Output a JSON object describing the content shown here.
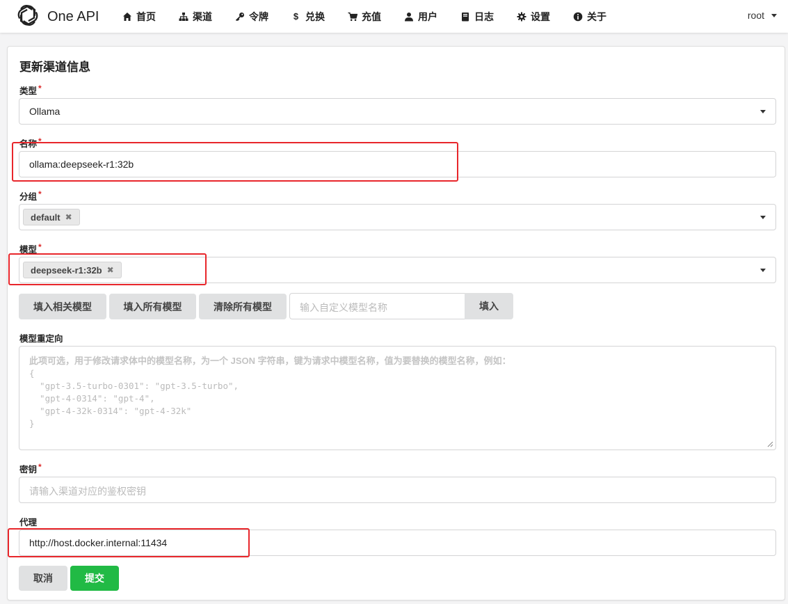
{
  "app": {
    "name": "One API"
  },
  "nav": [
    {
      "label": "首页",
      "icon": "home-icon"
    },
    {
      "label": "渠道",
      "icon": "sitemap-icon"
    },
    {
      "label": "令牌",
      "icon": "key-icon"
    },
    {
      "label": "兑换",
      "icon": "dollar-icon"
    },
    {
      "label": "充值",
      "icon": "cart-icon"
    },
    {
      "label": "用户",
      "icon": "user-icon"
    },
    {
      "label": "日志",
      "icon": "book-icon"
    },
    {
      "label": "设置",
      "icon": "gear-icon"
    },
    {
      "label": "关于",
      "icon": "info-icon"
    }
  ],
  "user": {
    "name": "root"
  },
  "form": {
    "title": "更新渠道信息",
    "required_mark": "*",
    "type": {
      "label": "类型",
      "value": "Ollama"
    },
    "name": {
      "label": "名称",
      "value": "ollama:deepseek-r1:32b"
    },
    "group": {
      "label": "分组",
      "chips": [
        "default"
      ]
    },
    "models": {
      "label": "模型",
      "chips": [
        "deepseek-r1:32b"
      ]
    },
    "model_buttons": {
      "fill_related": "填入相关模型",
      "fill_all": "填入所有模型",
      "clear_all": "清除所有模型",
      "custom_placeholder": "输入自定义模型名称",
      "fill": "填入"
    },
    "model_mapping": {
      "label": "模型重定向",
      "placeholder_lines": [
        "此项可选，用于修改请求体中的模型名称，为一个 JSON 字符串，键为请求中模型名称，值为要替换的模型名称，例如：",
        "{",
        "  \"gpt-3.5-turbo-0301\": \"gpt-3.5-turbo\",",
        "  \"gpt-4-0314\": \"gpt-4\",",
        "  \"gpt-4-32k-0314\": \"gpt-4-32k\"",
        "}"
      ]
    },
    "key": {
      "label": "密钥",
      "placeholder": "请输入渠道对应的鉴权密钥"
    },
    "proxy": {
      "label": "代理",
      "value": "http://host.docker.internal:11434"
    },
    "actions": {
      "cancel": "取消",
      "submit": "提交"
    }
  },
  "colors": {
    "submit": "#21ba45",
    "highlight": "#e8262b",
    "required": "#db2828"
  }
}
